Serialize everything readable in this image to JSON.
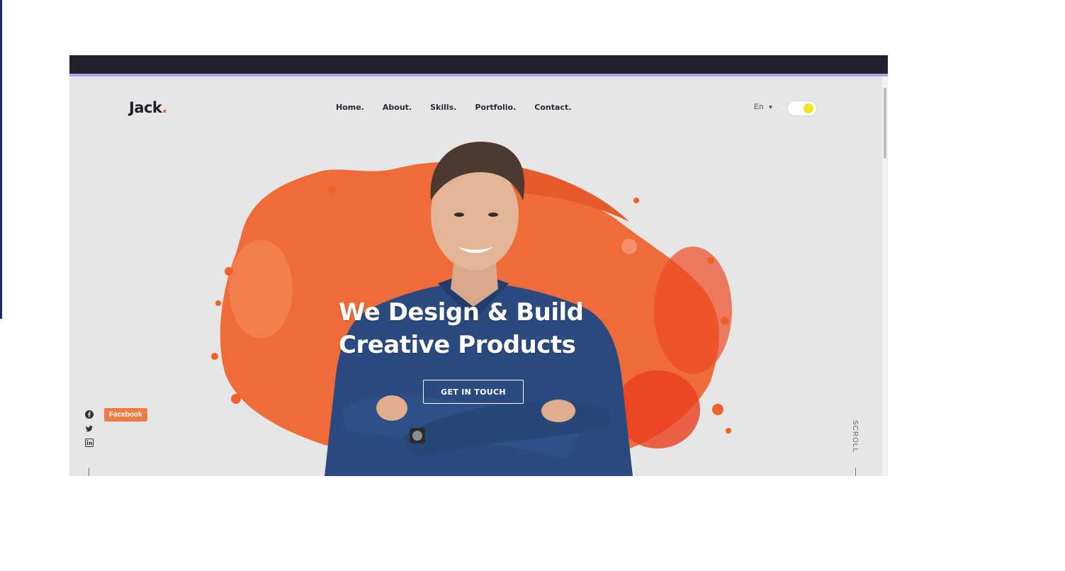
{
  "header": {
    "logo_text": "Jack",
    "logo_dot": ".",
    "nav": [
      {
        "label": "Home."
      },
      {
        "label": "About."
      },
      {
        "label": "Skills."
      },
      {
        "label": "Portfolio."
      },
      {
        "label": "Contact."
      }
    ],
    "language": "En",
    "theme_toggle": {
      "state": "light"
    }
  },
  "hero": {
    "headline_line1": "We Design & Build",
    "headline_line2": "Creative Products",
    "cta_label": "GET IN TOUCH",
    "image": "person-portrait-with-orange-paint-splash"
  },
  "social": {
    "icons": [
      "facebook-icon",
      "twitter-icon",
      "linkedin-icon"
    ],
    "tooltip": "Facebook"
  },
  "scroll_label": "SCROLL",
  "colors": {
    "accent": "#f0612a",
    "background": "#e6e6e6",
    "topbar": "#23212d",
    "toggle_knob": "#f1e51f"
  }
}
